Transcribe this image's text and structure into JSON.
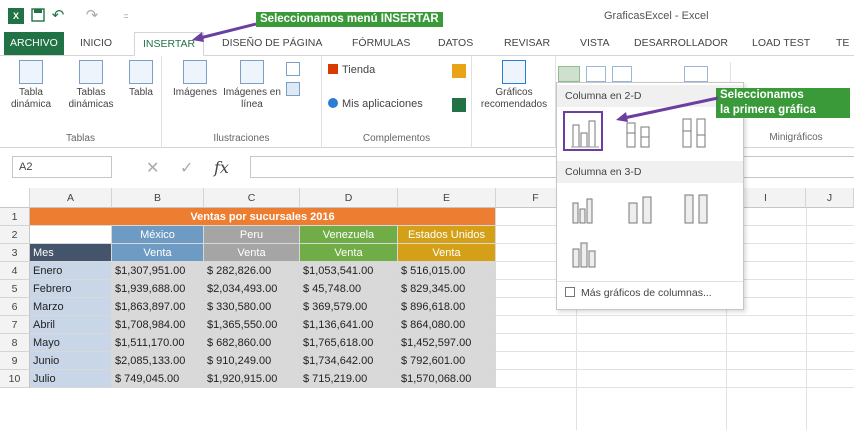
{
  "titlebar": {
    "window_title": "GraficasExcel - Excel",
    "undo_glyph": "↶",
    "redo_glyph": "↷",
    "quick_access_more": "="
  },
  "tabs": [
    {
      "label": "ARCHIVO"
    },
    {
      "label": "INICIO"
    },
    {
      "label": "INSERTAR"
    },
    {
      "label": "DISEÑO DE PÁGINA"
    },
    {
      "label": "FÓRMULAS"
    },
    {
      "label": "DATOS"
    },
    {
      "label": "REVISAR"
    },
    {
      "label": "VISTA"
    },
    {
      "label": "DESARROLLADOR"
    },
    {
      "label": "LOAD TEST"
    },
    {
      "label": "TE"
    }
  ],
  "ribbon": {
    "groups": {
      "tablas": "Tablas",
      "ilustraciones": "Ilustraciones",
      "complementos": "Complementos",
      "minigraficos": "Minigráficos"
    },
    "buttons": {
      "tabla_dinamica": "Tabla dinámica",
      "tablas_dinamicas": "Tablas dinámicas",
      "tabla": "Tabla",
      "imagenes": "Imágenes",
      "imagenes_linea": "Imágenes en línea",
      "tienda": "Tienda",
      "mis_aplicaciones": "Mis aplicaciones",
      "graficos_recomendados": "Gráficos recomendados"
    }
  },
  "formula_bar": {
    "name_box": "A2",
    "fx": "fx",
    "cancel": "✕",
    "confirm": "✓",
    "formula": ""
  },
  "columns": [
    "A",
    "B",
    "C",
    "D",
    "E",
    "F",
    "I",
    "J"
  ],
  "rows": [
    "1",
    "2",
    "3",
    "4",
    "5",
    "6",
    "7",
    "8",
    "9",
    "10"
  ],
  "table": {
    "title": "Ventas por sucursales 2016",
    "header_mes": "Mes",
    "countries": [
      "México",
      "Peru",
      "Venezuela",
      "Estados Unidos"
    ],
    "sub_header": "Venta",
    "country_colors": [
      "#6d9bc3",
      "#a5a5a5",
      "#70ad47",
      "#d4a017"
    ],
    "title_color": "#ed7d31",
    "rows": [
      {
        "mes": "Enero",
        "v": [
          "$1,307,951.00",
          "$   282,826.00",
          "$1,053,541.00",
          "$   516,015.00"
        ]
      },
      {
        "mes": "Febrero",
        "v": [
          "$1,939,688.00",
          "$2,034,493.00",
          "$      45,748.00",
          "$   829,345.00"
        ]
      },
      {
        "mes": "Marzo",
        "v": [
          "$1,863,897.00",
          "$   330,580.00",
          "$   369,579.00",
          "$   896,618.00"
        ]
      },
      {
        "mes": "Abril",
        "v": [
          "$1,708,984.00",
          "$1,365,550.00",
          "$1,136,641.00",
          "$   864,080.00"
        ]
      },
      {
        "mes": "Mayo",
        "v": [
          "$1,511,170.00",
          "$   682,860.00",
          "$1,765,618.00",
          "$1,452,597.00"
        ]
      },
      {
        "mes": "Junio",
        "v": [
          "$2,085,133.00",
          "$   910,249.00",
          "$1,734,642.00",
          "$   792,601.00"
        ]
      },
      {
        "mes": "Julio",
        "v": [
          "$   749,045.00",
          "$1,920,915.00",
          "$   715,219.00",
          "$1,570,068.00"
        ]
      }
    ]
  },
  "dropdown": {
    "section_2d": "Columna en 2-D",
    "section_3d": "Columna en 3-D",
    "more_charts": "Más gráficos de columnas..."
  },
  "callouts": {
    "insertar": "Seleccionamos menú INSERTAR",
    "primera_grafica_line1": "Seleccionamos",
    "primera_grafica_line2": "la primera gráfica"
  },
  "colors": {
    "excel_green": "#217346",
    "callout_green": "#3a9a3a",
    "arrow_purple": "#6a3fa0"
  }
}
